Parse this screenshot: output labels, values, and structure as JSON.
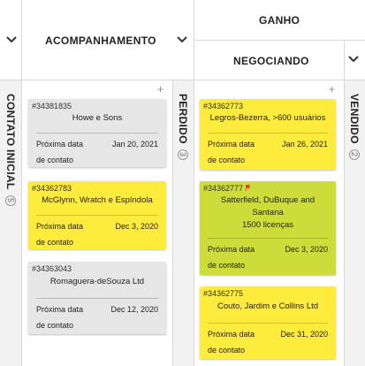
{
  "headers": {
    "ganho": "GANHO",
    "acompanhamento": "ACOMPANHAMENTO",
    "negociando": "NEGOCIANDO"
  },
  "side_lanes": {
    "contato_inicial": {
      "label": "CONTATO INICIAL",
      "count": "5"
    },
    "perdido": {
      "label": "PERDIDO",
      "count": "3"
    },
    "vendido": {
      "label": "VENDIDO",
      "count": "2"
    }
  },
  "add_glyph": "+",
  "next_contact_label": "Próxima data",
  "next_contact_label2": "de contato",
  "acompanhamento_cards": [
    {
      "id": "#34381835",
      "title": "Howe e Sons",
      "date": "Jan 20, 2021",
      "color": "#e6e6e6"
    },
    {
      "id": "#34362783",
      "title": "McGlynn, Wratch e Espíndola",
      "date": "Dec 3, 2020",
      "color": "#ffeb3b"
    },
    {
      "id": "#34363043",
      "title": "Romaguera-deSouza Ltd",
      "date": "Dec 12, 2020",
      "color": "#e6e6e6"
    }
  ],
  "negociando_cards": [
    {
      "id": "#34362773",
      "title": "Legros-Bezerra, >600 usuários",
      "date": "Jan 26, 2021",
      "color": "#ffeb3b"
    },
    {
      "id": "#34362777",
      "title_lines": [
        "Satterfield, DuBuque and",
        "Santana",
        "1500 licenças"
      ],
      "date": "Dec 3, 2020",
      "color": "#cddc39",
      "flag_color": "#e53935"
    },
    {
      "id": "#34362775",
      "title": "Couto, Jardim e Collins Ltd",
      "date": "Dec 31, 2020",
      "color": "#ffeb3b"
    }
  ],
  "icons": {
    "chevron": "chevron-down-icon",
    "flag": "flag-icon"
  }
}
